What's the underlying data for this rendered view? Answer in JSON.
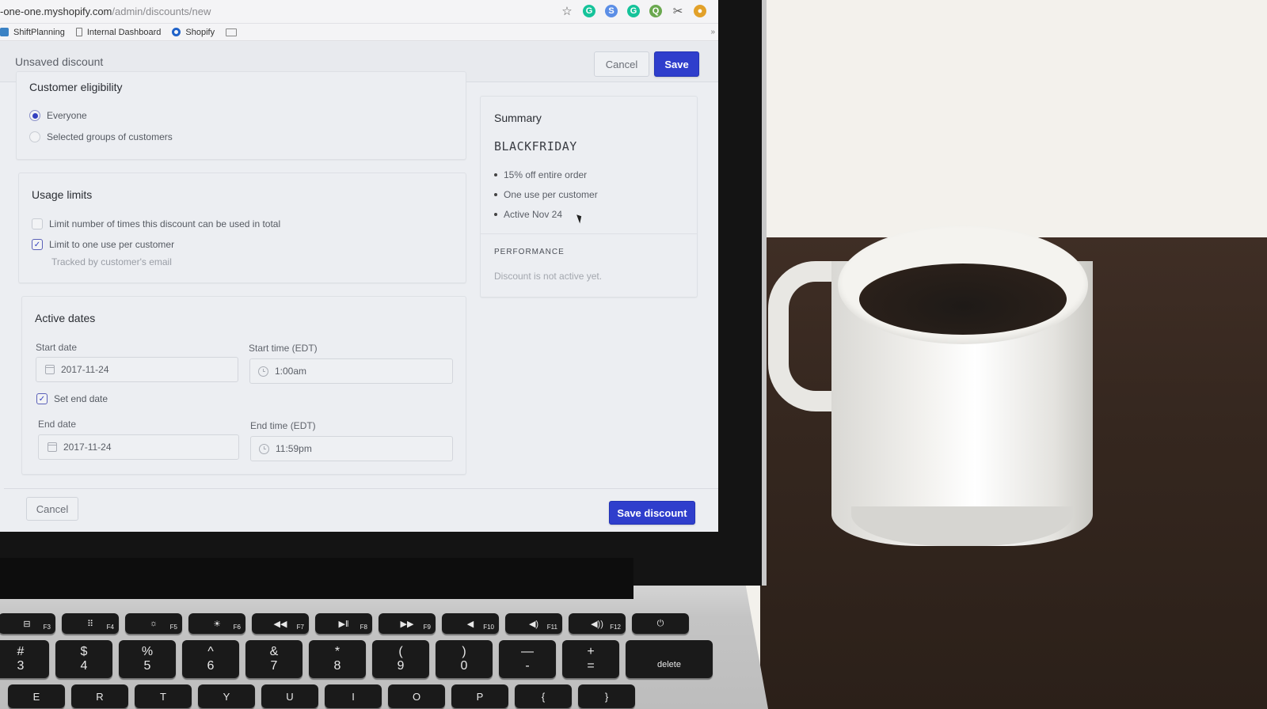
{
  "browser": {
    "url_host": "-one-one.myshopify.com",
    "url_path": "/admin/discounts/new",
    "bookmarks": [
      {
        "label": "ShiftPlanning",
        "icon": "user-icon"
      },
      {
        "label": "Internal Dashboard",
        "icon": "page-icon"
      },
      {
        "label": "Shopify",
        "icon": "circle-icon"
      },
      {
        "label": "",
        "icon": "folder-icon"
      }
    ],
    "bookmarks_more": "»",
    "extensions": [
      {
        "name": "bookmark-star-icon",
        "glyph": "☆",
        "color": ""
      },
      {
        "name": "grammarly-icon",
        "glyph": "G",
        "color": "#15c39a"
      },
      {
        "name": "shiftplanning-ext-icon",
        "glyph": "S",
        "color": "#5b8ee6"
      },
      {
        "name": "grammarly-square-icon",
        "glyph": "G",
        "color": "#15c39a"
      },
      {
        "name": "magnifier-icon",
        "glyph": "Q",
        "color": "#6aa84f"
      },
      {
        "name": "scissors-icon",
        "glyph": "✂",
        "color": ""
      },
      {
        "name": "vpn-shield-icon",
        "glyph": "●",
        "color": "#e2a12a"
      },
      {
        "name": "menu-dots-icon",
        "glyph": "⋮",
        "color": ""
      }
    ]
  },
  "topbar": {
    "title": "Unsaved discount",
    "cancel_label": "Cancel",
    "save_label": "Save"
  },
  "eligibility": {
    "title": "Customer eligibility",
    "options": [
      {
        "label": "Everyone",
        "selected": true
      },
      {
        "label": "Selected groups of customers",
        "selected": false
      }
    ]
  },
  "usage_limits": {
    "title": "Usage limits",
    "options": [
      {
        "label": "Limit number of times this discount can be used in total",
        "checked": false
      },
      {
        "label": "Limit to one use per customer",
        "checked": true
      }
    ],
    "help_text": "Tracked by customer's email"
  },
  "active_dates": {
    "title": "Active dates",
    "start_date_label": "Start date",
    "start_date_value": "2017-11-24",
    "start_time_label": "Start time (EDT)",
    "start_time_value": "1:00am",
    "set_end_date_label": "Set end date",
    "set_end_date_checked": true,
    "end_date_label": "End date",
    "end_date_value": "2017-11-24",
    "end_time_label": "End time (EDT)",
    "end_time_value": "11:59pm"
  },
  "summary": {
    "title": "Summary",
    "code": "BLACKFRIDAY",
    "bullets": [
      "15% off entire order",
      "One use per customer",
      "Active Nov 24"
    ],
    "performance_label": "PERFORMANCE",
    "performance_text": "Discount is not active yet."
  },
  "footer": {
    "cancel_label": "Cancel",
    "save_label": "Save discount"
  },
  "keyboard": {
    "function_keys": [
      {
        "glyph": "⊟",
        "sub": "F3"
      },
      {
        "glyph": "⠿",
        "sub": "F4"
      },
      {
        "glyph": "☼",
        "sub": "F5"
      },
      {
        "glyph": "☀",
        "sub": "F6"
      },
      {
        "glyph": "◀◀",
        "sub": "F7"
      },
      {
        "glyph": "▶‖",
        "sub": "F8"
      },
      {
        "glyph": "▶▶",
        "sub": "F9"
      },
      {
        "glyph": "◀",
        "sub": "F10"
      },
      {
        "glyph": "◀)",
        "sub": "F11"
      },
      {
        "glyph": "◀))",
        "sub": "F12"
      },
      {
        "glyph": "⏻",
        "sub": ""
      }
    ],
    "number_keys": [
      {
        "top": "#",
        "bottom": "3"
      },
      {
        "top": "$",
        "bottom": "4"
      },
      {
        "top": "%",
        "bottom": "5"
      },
      {
        "top": "^",
        "bottom": "6"
      },
      {
        "top": "&",
        "bottom": "7"
      },
      {
        "top": "*",
        "bottom": "8"
      },
      {
        "top": "(",
        "bottom": "9"
      },
      {
        "top": ")",
        "bottom": "0"
      },
      {
        "top": "—",
        "bottom": "-"
      },
      {
        "top": "+",
        "bottom": "="
      }
    ],
    "delete_label": "delete",
    "letter_keys": [
      "E",
      "R",
      "T",
      "Y",
      "U",
      "I",
      "O",
      "P",
      "{",
      "}"
    ]
  },
  "colors": {
    "primary": "#2f3ecc",
    "accent_check": "#3340c0"
  }
}
